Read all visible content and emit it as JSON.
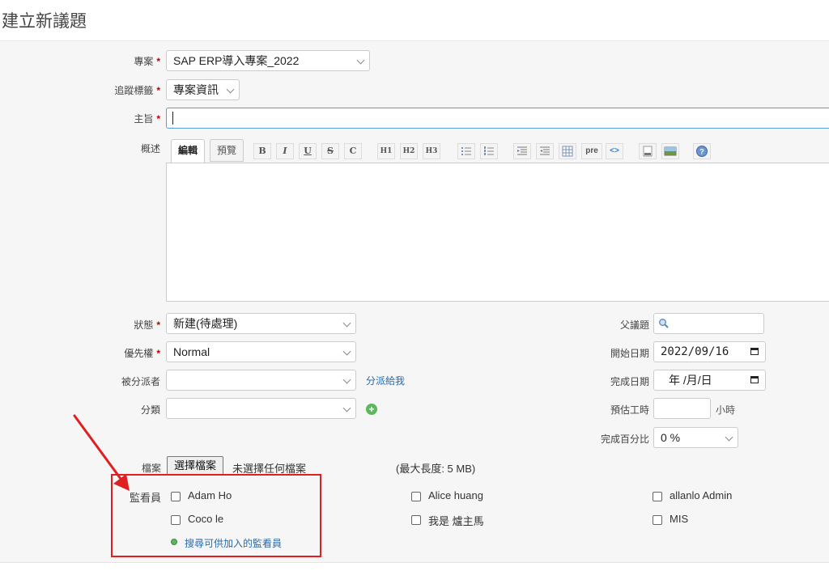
{
  "page_title": "建立新議題",
  "required_mark": "*",
  "fields": {
    "project": {
      "label": "專案",
      "value": "SAP ERP導入專案_2022"
    },
    "tracker": {
      "label": "追蹤標籤",
      "value": "專案資訊"
    },
    "subject": {
      "label": "主旨",
      "value": ""
    },
    "description": {
      "label": "概述",
      "tab_edit": "編輯",
      "tab_preview": "預覽"
    },
    "status": {
      "label": "狀態",
      "value": "新建(待處理)"
    },
    "priority": {
      "label": "優先權",
      "value": "Normal"
    },
    "assignee": {
      "label": "被分派者",
      "value": "",
      "assign_to_me": "分派給我"
    },
    "category": {
      "label": "分類",
      "value": "",
      "add_icon": "+"
    },
    "parent": {
      "label": "父議題",
      "value": ""
    },
    "start_date": {
      "label": "開始日期",
      "value": "2022/09/16"
    },
    "due_date": {
      "label": "完成日期",
      "value": "年 /月/日"
    },
    "estimated": {
      "label": "預估工時",
      "value": "",
      "unit": "小時"
    },
    "done_ratio": {
      "label": "完成百分比",
      "value": "0 %"
    },
    "files": {
      "label": "檔案",
      "button": "選擇檔案",
      "no_file": "未選擇任何檔案",
      "max_size": "(最大長度: 5 MB)"
    },
    "watchers": {
      "label": "監看員",
      "users": [
        "Adam Ho",
        "Alice huang",
        "allanlo Admin",
        "Coco le",
        "我是 爐主馬",
        "MIS"
      ],
      "search_link": "搜尋可供加入的監看員"
    }
  },
  "toolbar": {
    "buttons": [
      "bold-icon",
      "italic-icon",
      "underline-icon",
      "strikethrough-icon",
      "code-inline-icon",
      "heading1-icon",
      "heading2-icon",
      "heading3-icon",
      "unordered-list-icon",
      "ordered-list-icon",
      "indent-right-icon",
      "indent-left-icon",
      "table-icon",
      "pre-icon",
      "code-highlight-icon",
      "link-icon",
      "image-icon",
      "help-icon"
    ],
    "labels": {
      "bold": "B",
      "italic": "I",
      "underline": "U",
      "strike": "S",
      "code": "C",
      "h1": "H1",
      "h2": "H2",
      "h3": "H3",
      "pre": "pre",
      "code_hl": "<>",
      "help": "?"
    }
  },
  "colors": {
    "required": "#bb0000",
    "link": "#2a6aa8",
    "annotation": "#e02020",
    "add": "#5cb85c"
  }
}
